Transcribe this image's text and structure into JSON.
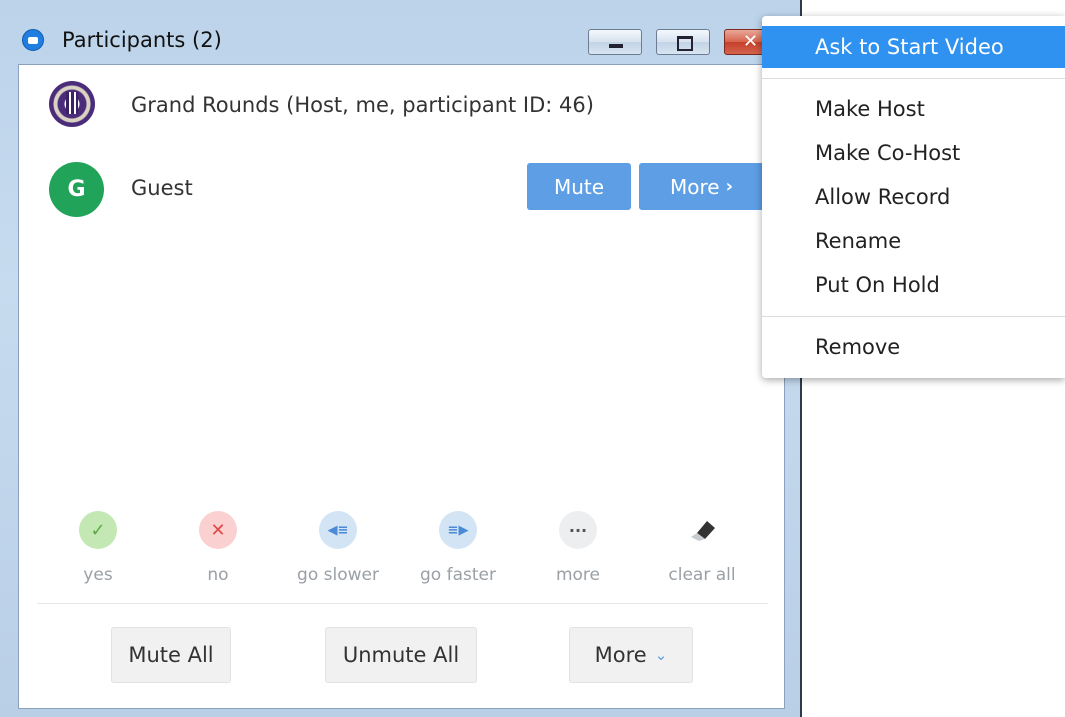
{
  "window": {
    "title": "Participants (2)",
    "close_glyph": "✕"
  },
  "participants": [
    {
      "name": "Grand Rounds (Host, me, participant ID: 46)",
      "avatar": "university-seal"
    },
    {
      "name": "Guest",
      "avatar_letter": "G",
      "mute_label": "Mute",
      "more_label": "More",
      "more_chevron": "›"
    }
  ],
  "reactions": [
    {
      "label": "yes",
      "glyph": "✓"
    },
    {
      "label": "no",
      "glyph": "✕"
    },
    {
      "label": "go slower",
      "glyph": "◀≡"
    },
    {
      "label": "go faster",
      "glyph": "≡▶"
    },
    {
      "label": "more",
      "glyph": "···"
    },
    {
      "label": "clear all",
      "glyph": "⌫"
    }
  ],
  "footer": {
    "mute_all": "Mute All",
    "unmute_all": "Unmute All",
    "more": "More",
    "more_chevron": "⌄"
  },
  "context_menu": {
    "items": [
      "Ask to Start Video",
      "Make Host",
      "Make Co-Host",
      "Allow Record",
      "Rename",
      "Put On Hold",
      "Remove"
    ],
    "highlighted_index": 0
  },
  "colors": {
    "accent_blue": "#5d9ee5",
    "menu_highlight": "#2f91f0",
    "guest_avatar": "#21a45a"
  }
}
